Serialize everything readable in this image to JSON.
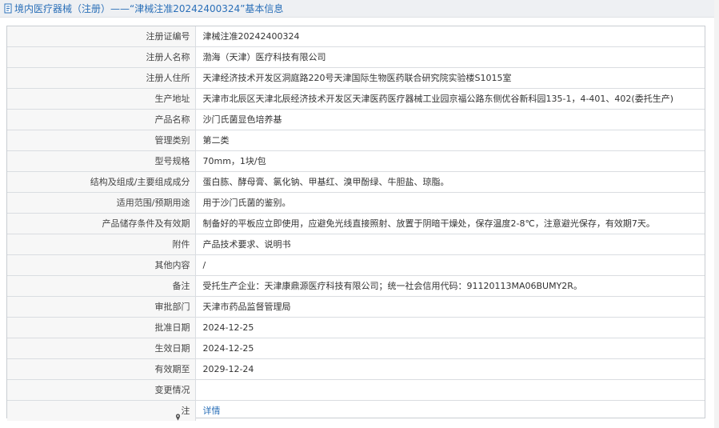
{
  "header": {
    "title": "境内医疗器械（注册）——“津械注准20242400324”基本信息",
    "icon": "document-icon"
  },
  "rows": [
    {
      "label": "注册证编号",
      "value": "津械注准20242400324"
    },
    {
      "label": "注册人名称",
      "value": "渤海（天津）医疗科技有限公司"
    },
    {
      "label": "注册人住所",
      "value": "天津经济技术开发区洞庭路220号天津国际生物医药联合研究院实验楼S1015室"
    },
    {
      "label": "生产地址",
      "value": "天津市北辰区天津北辰经济技术开发区天津医药医疗器械工业园京福公路东侧优谷新科园135-1，4-401、402(委托生产)"
    },
    {
      "label": "产品名称",
      "value": "沙门氏菌显色培养基"
    },
    {
      "label": "管理类别",
      "value": "第二类"
    },
    {
      "label": "型号规格",
      "value": "70mm，1块/包"
    },
    {
      "label": "结构及组成/主要组成成分",
      "value": "蛋白胨、酵母膏、氯化钠、甲基红、溴甲酚绿、牛胆盐、琼脂。"
    },
    {
      "label": "适用范围/预期用途",
      "value": "用于沙门氏菌的鉴别。"
    },
    {
      "label": "产品储存条件及有效期",
      "value": "制备好的平板应立即使用，应避免光线直接照射、放置于阴暗干燥处，保存温度2-8℃，注意避光保存，有效期7天。"
    },
    {
      "label": "附件",
      "value": "产品技术要求、说明书"
    },
    {
      "label": "其他内容",
      "value": "/"
    },
    {
      "label": "备注",
      "value": "受托生产企业：天津康鼎源医疗科技有限公司；统一社会信用代码：91120113MA06BUMY2R。"
    },
    {
      "label": "审批部门",
      "value": "天津市药品监督管理局"
    },
    {
      "label": "批准日期",
      "value": "2024-12-25"
    },
    {
      "label": "生效日期",
      "value": "2024-12-25"
    },
    {
      "label": "有效期至",
      "value": "2029-12-24"
    },
    {
      "label": "变更情况",
      "value": ""
    }
  ],
  "note_row": {
    "label": "注",
    "icon": "pin-icon",
    "link_text": "详情"
  },
  "colors": {
    "header_bg": "#eef0f3",
    "link": "#2a6fb8",
    "label_bg": "#f7f7f7",
    "border": "#dadde1"
  }
}
